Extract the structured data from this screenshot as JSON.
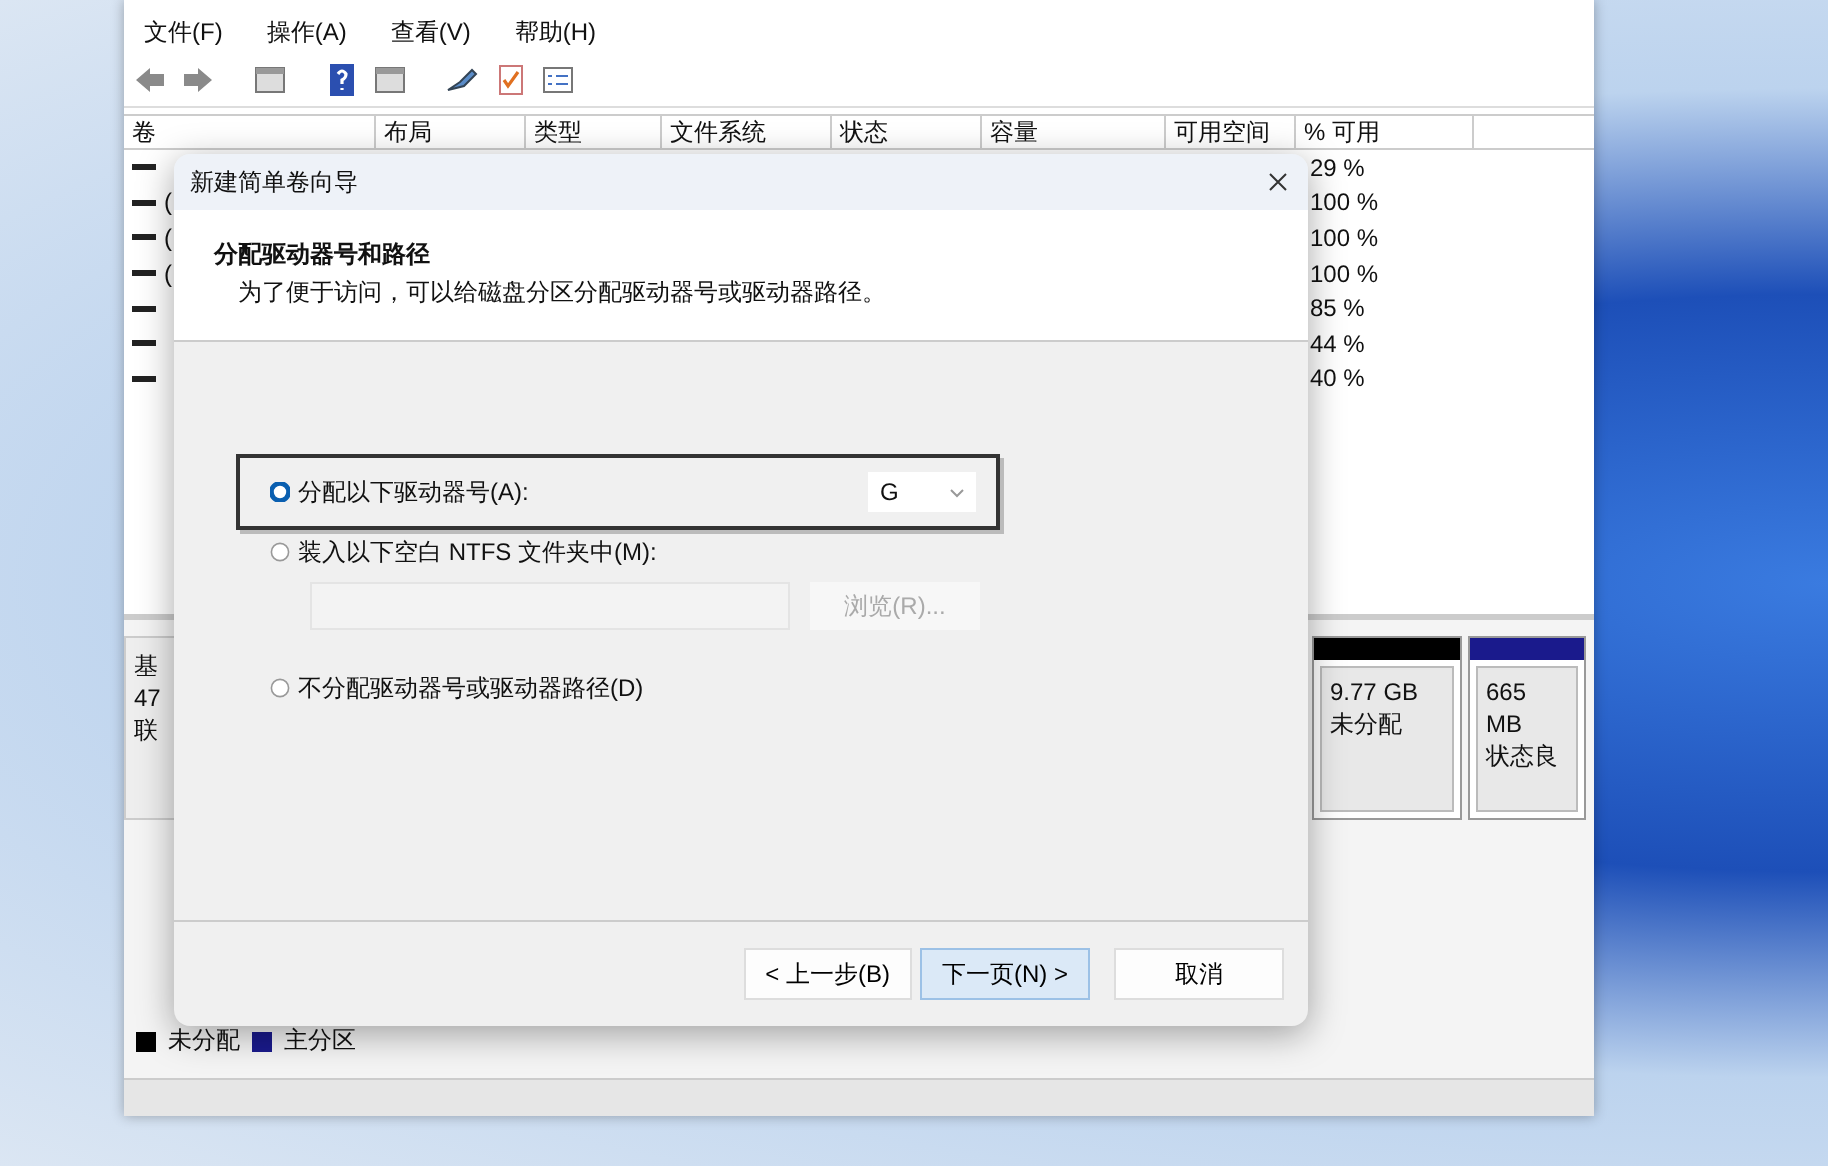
{
  "menu": [
    "文件(F)",
    "操作(A)",
    "查看(V)",
    "帮助(H)"
  ],
  "table": {
    "columns": [
      "卷",
      "布局",
      "类型",
      "文件系统",
      "状态",
      "容量",
      "可用空间",
      "% 可用"
    ],
    "rows": [
      {
        "pct": "29 %"
      },
      {
        "volume": "(",
        "pct": "100 %"
      },
      {
        "volume": "(",
        "pct": "100 %"
      },
      {
        "volume": "(",
        "pct": "100 %"
      },
      {
        "pct": "85 %"
      },
      {
        "pct": "44 %"
      },
      {
        "pct": "40 %"
      }
    ]
  },
  "disk": {
    "label_lines": [
      "基",
      "47",
      "联"
    ],
    "partitions": [
      {
        "size": "9.77 GB",
        "status": "未分配",
        "color": "#000000"
      },
      {
        "size": "665 MB",
        "status": "状态良",
        "color": "#1a1a8c"
      }
    ]
  },
  "legend": [
    {
      "label": "未分配",
      "color": "#000000"
    },
    {
      "label": "主分区",
      "color": "#1a1a8c"
    }
  ],
  "dialog": {
    "title": "新建简单卷向导",
    "heading": "分配驱动器号和路径",
    "subtitle": "为了便于访问，可以给磁盘分区分配驱动器号或驱动器路径。",
    "options": [
      {
        "kind": "letter",
        "label": "分配以下驱动器号(A):",
        "selected": true,
        "value": "G"
      },
      {
        "kind": "folder",
        "label": "装入以下空白 NTFS 文件夹中(M):",
        "selected": false,
        "browse": "浏览(R)..."
      },
      {
        "kind": "none",
        "label": "不分配驱动器号或驱动器路径(D)",
        "selected": false
      }
    ],
    "buttons": [
      {
        "label": "< 上一步(B)",
        "default": false
      },
      {
        "label": "下一页(N) >",
        "default": true
      },
      {
        "label": "取消",
        "default": false
      }
    ]
  }
}
